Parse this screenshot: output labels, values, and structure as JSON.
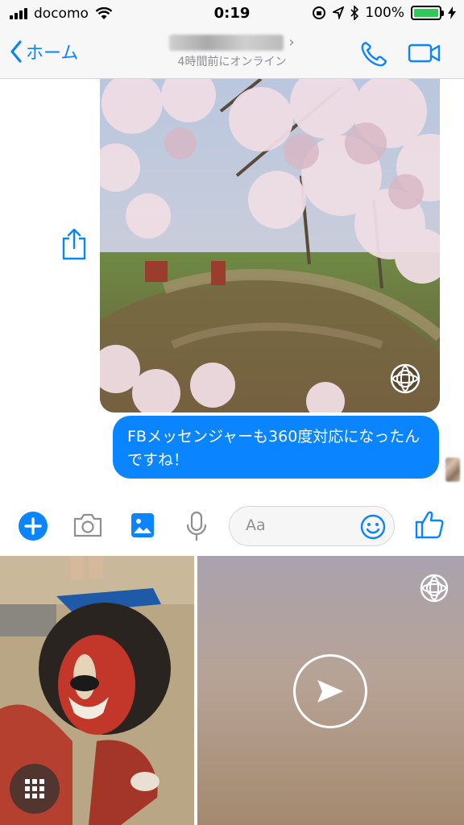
{
  "status_bar": {
    "carrier": "docomo",
    "time": "0:19",
    "battery_percent": "100%",
    "icons": [
      "signal-icon",
      "wifi-icon",
      "screen-rotation-lock-icon",
      "location-icon",
      "bluetooth-icon",
      "battery-icon",
      "charging-icon"
    ]
  },
  "nav": {
    "back_label": "ホーム",
    "presence": "4時間前にオンライン",
    "accent": "#0a84ff"
  },
  "messages": {
    "photo_icons": [
      "share-icon",
      "panorama-360-icon"
    ],
    "text": "FBメッセンジャーも360度対応になったんですね！",
    "bubble_color": "#0a84ff"
  },
  "composer": {
    "placeholder": "Aa",
    "icons": [
      "plus-icon",
      "camera-icon",
      "gallery-icon",
      "microphone-icon",
      "emoji-icon",
      "thumbs-up-icon"
    ]
  },
  "gallery": {
    "icons": [
      "grid-icon",
      "panorama-360-icon",
      "send-icon"
    ]
  }
}
